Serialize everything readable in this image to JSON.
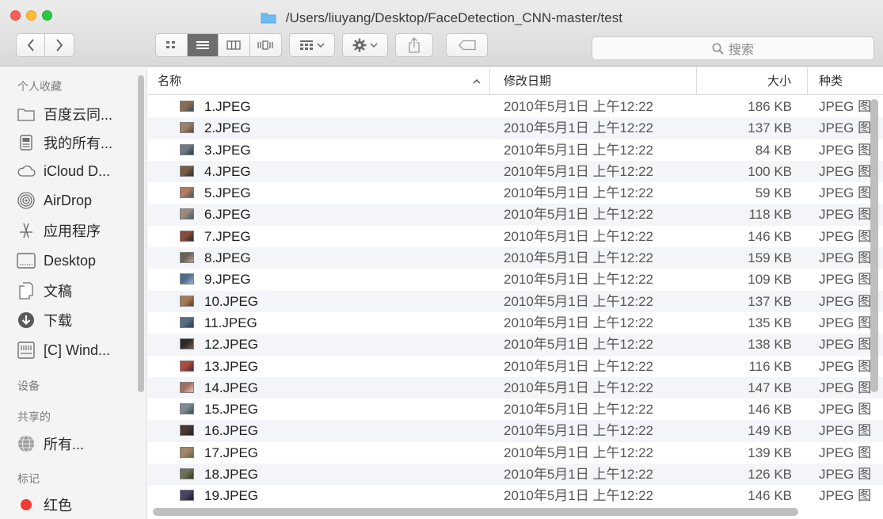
{
  "window": {
    "title": "/Users/liuyang/Desktop/FaceDetection_CNN-master/test"
  },
  "toolbar": {
    "search_placeholder": "搜索"
  },
  "sidebar": {
    "sections": [
      {
        "heading": "个人收藏"
      },
      {
        "heading": "设备"
      },
      {
        "heading": "共享的"
      },
      {
        "heading": "标记"
      }
    ],
    "favorites": [
      {
        "label": "百度云同...",
        "icon": "folder-icon"
      },
      {
        "label": "我的所有...",
        "icon": "all-files-icon"
      },
      {
        "label": "iCloud D...",
        "icon": "cloud-icon"
      },
      {
        "label": "AirDrop",
        "icon": "airdrop-icon"
      },
      {
        "label": "应用程序",
        "icon": "applications-icon"
      },
      {
        "label": "Desktop",
        "icon": "desktop-icon"
      },
      {
        "label": "文稿",
        "icon": "documents-icon"
      },
      {
        "label": "下载",
        "icon": "downloads-icon"
      },
      {
        "label": "[C] Wind...",
        "icon": "drive-icon"
      }
    ],
    "shared": [
      {
        "label": "所有...",
        "icon": "network-icon"
      }
    ],
    "tags": [
      {
        "label": "红色",
        "icon": "tag-dot-icon",
        "color": "#f33a30"
      }
    ]
  },
  "list": {
    "columns": {
      "name": "名称",
      "date": "修改日期",
      "size": "大小",
      "kind": "种类"
    },
    "files": [
      {
        "name": "1.JPEG",
        "date": "2010年5月1日 上午12:22",
        "size": "186 KB",
        "kind": "JPEG 图"
      },
      {
        "name": "2.JPEG",
        "date": "2010年5月1日 上午12:22",
        "size": "137 KB",
        "kind": "JPEG 图"
      },
      {
        "name": "3.JPEG",
        "date": "2010年5月1日 上午12:22",
        "size": "84 KB",
        "kind": "JPEG 图"
      },
      {
        "name": "4.JPEG",
        "date": "2010年5月1日 上午12:22",
        "size": "100 KB",
        "kind": "JPEG 图"
      },
      {
        "name": "5.JPEG",
        "date": "2010年5月1日 上午12:22",
        "size": "59 KB",
        "kind": "JPEG 图"
      },
      {
        "name": "6.JPEG",
        "date": "2010年5月1日 上午12:22",
        "size": "118 KB",
        "kind": "JPEG 图"
      },
      {
        "name": "7.JPEG",
        "date": "2010年5月1日 上午12:22",
        "size": "146 KB",
        "kind": "JPEG 图"
      },
      {
        "name": "8.JPEG",
        "date": "2010年5月1日 上午12:22",
        "size": "159 KB",
        "kind": "JPEG 图"
      },
      {
        "name": "9.JPEG",
        "date": "2010年5月1日 上午12:22",
        "size": "109 KB",
        "kind": "JPEG 图"
      },
      {
        "name": "10.JPEG",
        "date": "2010年5月1日 上午12:22",
        "size": "137 KB",
        "kind": "JPEG 图"
      },
      {
        "name": "11.JPEG",
        "date": "2010年5月1日 上午12:22",
        "size": "135 KB",
        "kind": "JPEG 图"
      },
      {
        "name": "12.JPEG",
        "date": "2010年5月1日 上午12:22",
        "size": "138 KB",
        "kind": "JPEG 图"
      },
      {
        "name": "13.JPEG",
        "date": "2010年5月1日 上午12:22",
        "size": "116 KB",
        "kind": "JPEG 图"
      },
      {
        "name": "14.JPEG",
        "date": "2010年5月1日 上午12:22",
        "size": "147 KB",
        "kind": "JPEG 图"
      },
      {
        "name": "15.JPEG",
        "date": "2010年5月1日 上午12:22",
        "size": "146 KB",
        "kind": "JPEG 图"
      },
      {
        "name": "16.JPEG",
        "date": "2010年5月1日 上午12:22",
        "size": "149 KB",
        "kind": "JPEG 图"
      },
      {
        "name": "17.JPEG",
        "date": "2010年5月1日 上午12:22",
        "size": "139 KB",
        "kind": "JPEG 图"
      },
      {
        "name": "18.JPEG",
        "date": "2010年5月1日 上午12:22",
        "size": "126 KB",
        "kind": "JPEG 图"
      },
      {
        "name": "19.JPEG",
        "date": "2010年5月1日 上午12:22",
        "size": "146 KB",
        "kind": "JPEG 图"
      }
    ]
  },
  "colors": {
    "close": "#fc5f57",
    "minimize": "#fdbc2e",
    "maximize": "#28c840",
    "folder_accent": "#5fb3f0",
    "row_stripe": "#f3f5f8"
  }
}
